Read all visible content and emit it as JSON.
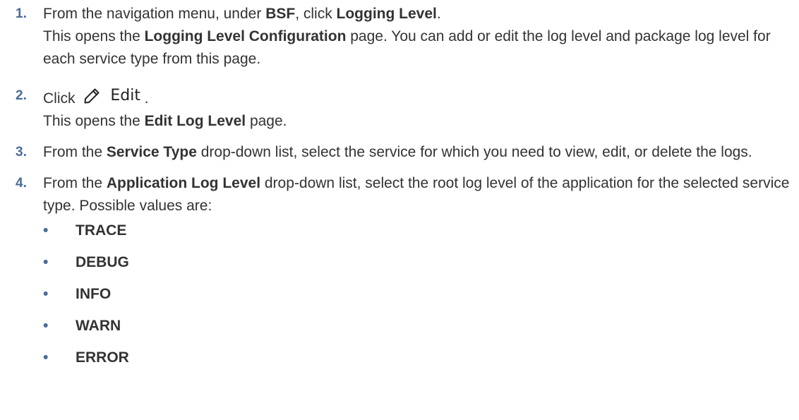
{
  "steps": [
    {
      "num": "1.",
      "parts": [
        "From the navigation menu, under ",
        "BSF",
        ", click ",
        "Logging Level",
        "."
      ],
      "line2": [
        "This opens the ",
        "Logging Level Configuration",
        " page. You can add or edit the log level and package log level for each service type from this page."
      ]
    },
    {
      "num": "2.",
      "click_label": "Click",
      "edit_label": "Edit",
      "period": ".",
      "line2": [
        "This opens the ",
        "Edit Log Level",
        " page."
      ]
    },
    {
      "num": "3.",
      "parts": [
        "From the ",
        "Service Type",
        " drop-down list, select the service for which you need to view, edit, or delete the logs."
      ]
    },
    {
      "num": "4.",
      "parts": [
        "From the ",
        "Application Log Level",
        " drop-down list, select the root log level of the application for the selected service type. Possible values are:"
      ],
      "bullet": "•",
      "values": [
        "TRACE",
        "DEBUG",
        "INFO",
        "WARN",
        "ERROR"
      ]
    }
  ],
  "icons": {
    "edit": "pencil-icon"
  },
  "colors": {
    "step_number": "#4a6c96",
    "text": "#333333"
  }
}
